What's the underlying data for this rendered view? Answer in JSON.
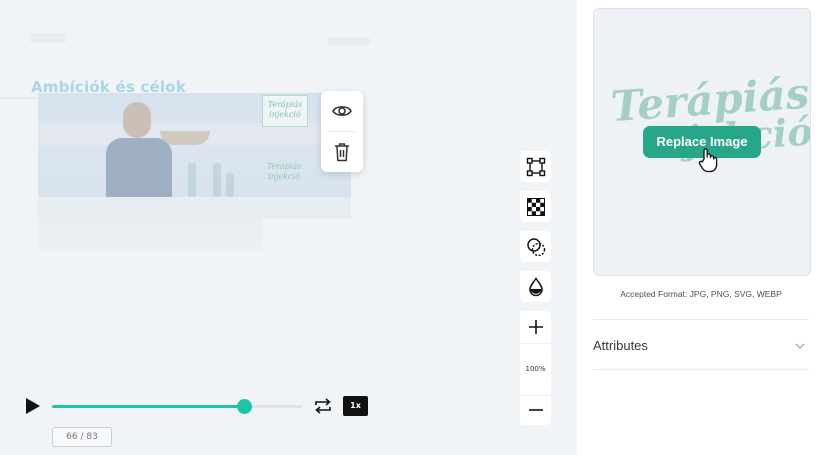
{
  "slide": {
    "title": "Ambíciók és célok",
    "logo_line1": "Terápiás",
    "logo_line2": "injekció"
  },
  "popup": {
    "icons": [
      "eye-icon",
      "trash-icon"
    ]
  },
  "tools": {
    "icons": [
      "transform-icon",
      "transparency-icon",
      "blend-icon",
      "opacity-drop-icon"
    ],
    "zoom": "100%",
    "zoom_in": "plus-icon",
    "zoom_out": "minus-icon"
  },
  "playback": {
    "progress": 0.77,
    "speed": "1x",
    "frame_current": "66",
    "frame_total": "83",
    "frame_separator": " / "
  },
  "side_panel": {
    "art_line1": "Terápiás",
    "art_line2": "injekció",
    "replace_button": "Replace Image",
    "accepted_formats": "Accepted Format: JPG, PNG, SVG, WEBP",
    "attributes_label": "Attributes"
  },
  "colors": {
    "accent": "#1ec4a6",
    "button": "#27a689"
  }
}
